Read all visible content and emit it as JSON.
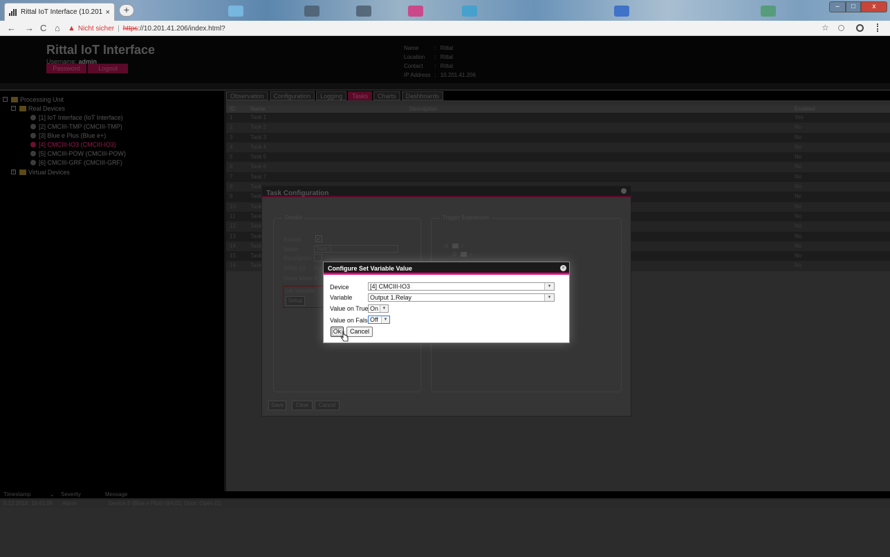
{
  "browser": {
    "tab_title": "Rittal IoT Interface (10.201.41.20(",
    "tab_close": "×",
    "new_tab": "+",
    "back": "←",
    "forward": "→",
    "reload": "C",
    "home": "⌂",
    "warning_icon": "▲",
    "not_secure": "Nicht sicher",
    "separator": "|",
    "url_scheme": "https",
    "url_rest": "://10.201.41.206/index.html?",
    "star": "☆",
    "win_min": "–",
    "win_max": "□",
    "win_close": "x"
  },
  "header": {
    "title": "Rittal IoT Interface",
    "username_label": "Username:",
    "username": "admin",
    "password_button": "Password",
    "logout_button": "Logout",
    "device_info": [
      {
        "label": "Name",
        "sep": ":",
        "value": "Rittal"
      },
      {
        "label": "Location",
        "sep": ":",
        "value": "Rittal"
      },
      {
        "label": "Contact",
        "sep": ":",
        "value": "Rittal"
      },
      {
        "label": "IP Address",
        "sep": ":",
        "value": "10.201.41.206"
      }
    ]
  },
  "tree": {
    "root": "Processing Unit",
    "real_devices": "Real Devices",
    "devices": [
      "[1] IoT Interface (IoT Interface)",
      "[2] CMCIII-TMP (CMCIII-TMP)",
      "[3] Blue e Plus (Blue e+)",
      "[4] CMCIII-IO3 (CMCIII-IO3)",
      "[5] CMCIII-POW (CMCIII-POW)",
      "[6] CMCIII-GRF (CMCIII-GRF)"
    ],
    "virtual_devices": "Virtual Devices",
    "expand_minus": "−",
    "expand_plus": "+"
  },
  "tabs": [
    "Observation",
    "Configuration",
    "Logging",
    "Tasks",
    "Charts",
    "Dashboards"
  ],
  "tasks": {
    "columns": {
      "id": "ID",
      "name": "Name",
      "description": "Description",
      "enabled": "Enabled"
    },
    "rows": [
      {
        "id": "1",
        "name": "Task 1",
        "enabled": "Yes"
      },
      {
        "id": "2",
        "name": "Task 2",
        "enabled": "No"
      },
      {
        "id": "3",
        "name": "Task 3",
        "enabled": "No"
      },
      {
        "id": "4",
        "name": "Task 4",
        "enabled": "No"
      },
      {
        "id": "5",
        "name": "Task 5",
        "enabled": "No"
      },
      {
        "id": "6",
        "name": "Task 6",
        "enabled": "No"
      },
      {
        "id": "7",
        "name": "Task 7",
        "enabled": "No"
      },
      {
        "id": "8",
        "name": "Task",
        "enabled": "No"
      },
      {
        "id": "9",
        "name": "Task",
        "enabled": "No"
      },
      {
        "id": "10",
        "name": "Task",
        "enabled": "No"
      },
      {
        "id": "11",
        "name": "Task",
        "enabled": "No"
      },
      {
        "id": "12",
        "name": "Task",
        "enabled": "No"
      },
      {
        "id": "13",
        "name": "Task",
        "enabled": "No"
      },
      {
        "id": "14",
        "name": "Task",
        "enabled": "No"
      },
      {
        "id": "15",
        "name": "Task",
        "enabled": "No"
      },
      {
        "id": "16",
        "name": "Task",
        "enabled": "No"
      }
    ]
  },
  "log": {
    "columns": {
      "timestamp": "Timestamp",
      "severity": "Severity",
      "message": "Message"
    },
    "sort_arrow": "⌄",
    "row": {
      "timestamp": "5.12.2018, 10:41:06",
      "severity": "Alarm",
      "message": "Device 3 (Blue e Plus) @4.01, Door: Open (1)"
    }
  },
  "task_dialog": {
    "title": "Task Configuration",
    "details_legend": "Details",
    "enable_label": "Enable",
    "enable_check": "✓",
    "name_label": "Name",
    "name_value": "Task 1",
    "description_label": "Description",
    "delay_label": "Delay [s]",
    "delay_value": "0",
    "delay_mode_label": "Delay Mode",
    "delay_mode_value": "S",
    "action_label": "Set Variable",
    "setup_button": "Setup",
    "trigger_legend": "Trigger Expression",
    "trigger_root": "I",
    "trigger_child": "=",
    "tree_toggle": "⊟",
    "save_button": "Save",
    "clear_button": "Clear",
    "cancel_button": "Cancel"
  },
  "setvar_dialog": {
    "title": "Configure Set Variable Value",
    "device_label": "Device",
    "device_value": "[4] CMCIII-IO3",
    "variable_label": "Variable",
    "variable_value": "Output 1.Relay",
    "true_label": "Value on True",
    "true_value": "On",
    "false_label": "Value on False",
    "false_value": "Off",
    "ok_button": "Ok",
    "cancel_button": "Cancel",
    "dropdown_arrow": "▼",
    "close_x": "×"
  },
  "colors": {
    "accent": "#e0007a",
    "dim_accent": "#5a0a28",
    "background": "#2a2a2a"
  }
}
